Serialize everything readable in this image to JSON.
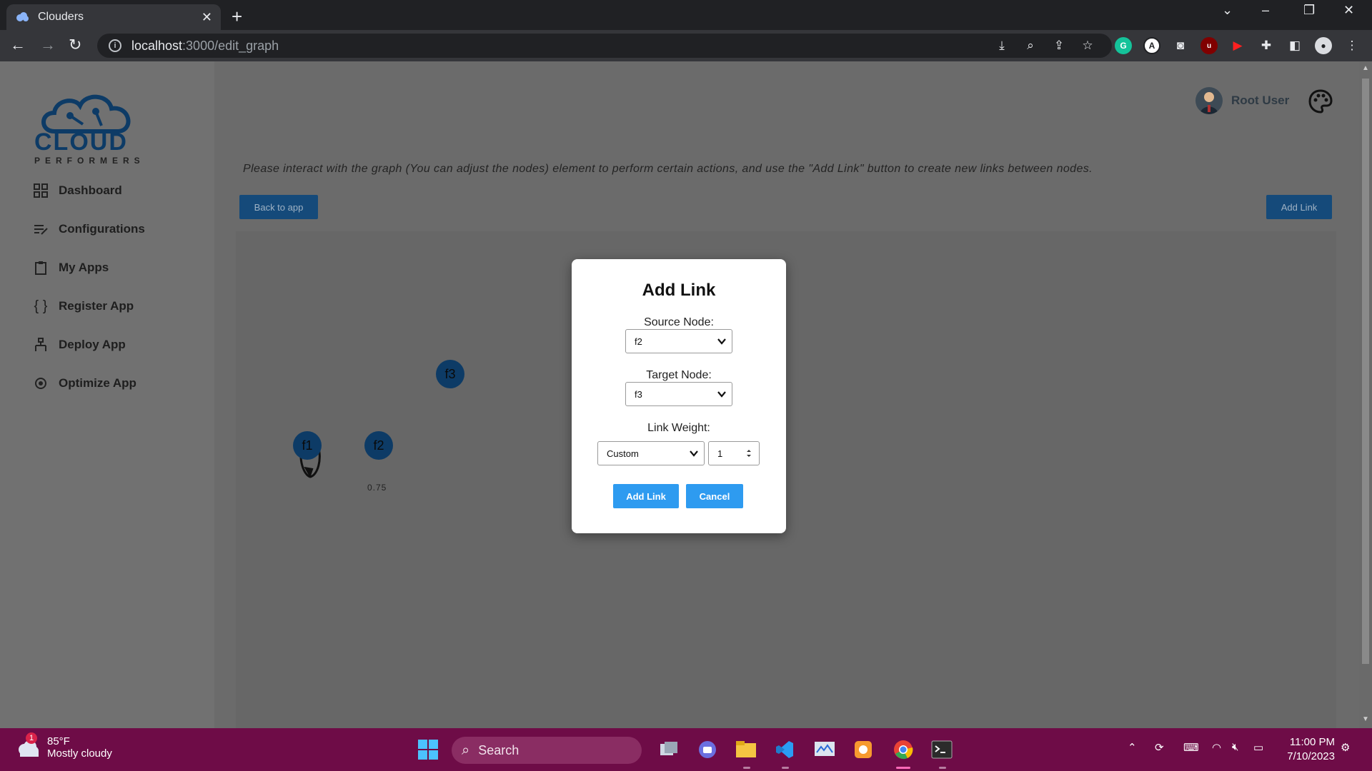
{
  "browser": {
    "tab_title": "Clouders",
    "url_host": "localhost",
    "url_path": ":3000/edit_graph"
  },
  "sidebar": {
    "logo_text": "CLOUD",
    "logo_subtext": "PERFORMERS",
    "items": [
      {
        "label": "Dashboard",
        "icon": "dashboard-grid-icon"
      },
      {
        "label": "Configurations",
        "icon": "list-edit-icon"
      },
      {
        "label": "My Apps",
        "icon": "clipboard-icon"
      },
      {
        "label": "Register App",
        "icon": "braces-icon"
      },
      {
        "label": "Deploy App",
        "icon": "hierarchy-icon"
      },
      {
        "label": "Optimize App",
        "icon": "optimize-cycle-icon"
      }
    ]
  },
  "header": {
    "user_name": "Root User"
  },
  "main": {
    "instructions": "Please interact with the graph (You can adjust the nodes) element to perform certain actions, and use the \"Add Link\" button to create new links between nodes.",
    "back_button": "Back to app",
    "add_link_button": "Add Link"
  },
  "graph": {
    "nodes": [
      {
        "id": "f1"
      },
      {
        "id": "f2"
      },
      {
        "id": "f3"
      }
    ],
    "links": [
      {
        "source": "f2",
        "target": "f2",
        "weight": "0.75"
      }
    ]
  },
  "modal": {
    "title": "Add Link",
    "source_label": "Source Node:",
    "source_value": "f2",
    "target_label": "Target Node:",
    "target_value": "f3",
    "weight_label": "Link Weight:",
    "weight_mode": "Custom",
    "weight_value": "1",
    "confirm_button": "Add Link",
    "cancel_button": "Cancel"
  },
  "taskbar": {
    "weather_temp": "85°F",
    "weather_desc": "Mostly cloudy",
    "weather_badge": "1",
    "search_label": "Search",
    "time": "11:00 PM",
    "date": "7/10/2023"
  },
  "colors": {
    "accent": "#2e9bf0",
    "node": "#0d3b66",
    "taskbar": "#6e0c47"
  }
}
